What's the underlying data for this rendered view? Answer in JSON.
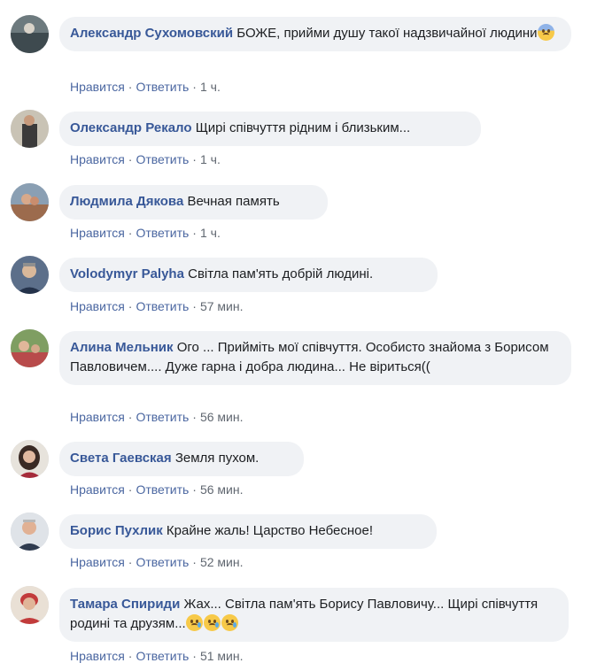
{
  "top_partial": "·",
  "comments": [
    {
      "author": "Александр Сухомовский",
      "text": "БОЖЕ, прийми душу такої надзвичайної людини",
      "emojis": [
        "fearful-face"
      ],
      "like": "Нравится",
      "reply": "Ответить",
      "time": "1 ч."
    },
    {
      "author": "Олександр Рекало",
      "text": "Щирі співчуття рідним і близьким...",
      "emojis": [],
      "like": "Нравится",
      "reply": "Ответить",
      "time": "1 ч."
    },
    {
      "author": "Людмила Дякова",
      "text": "Вечная память",
      "emojis": [],
      "like": "Нравится",
      "reply": "Ответить",
      "time": "1 ч."
    },
    {
      "author": "Volodymyr Palyha",
      "text": "Світла пам'ять добрій людині.",
      "emojis": [],
      "like": "Нравится",
      "reply": "Ответить",
      "time": "57 мин."
    },
    {
      "author": "Алина Мельник",
      "text": "Ого ... Прийміть мої співчуття. Особисто знайома з Борисом Павловичем.... Дуже гарна і добра людина... Не віриться((",
      "emojis": [],
      "like": "Нравится",
      "reply": "Ответить",
      "time": "56 мин."
    },
    {
      "author": "Света Гаевская",
      "text": "Земля пухом.",
      "emojis": [],
      "like": "Нравится",
      "reply": "Ответить",
      "time": "56 мин."
    },
    {
      "author": "Борис Пухлик",
      "text": "Крайне жаль! Царство Небесное!",
      "emojis": [],
      "like": "Нравится",
      "reply": "Ответить",
      "time": "52 мин."
    },
    {
      "author": "Тамара Спириди",
      "text": "Жах... Світла пам'ять Борису Павловичу... Щирі співчуття родині та друзям...",
      "emojis": [
        "crying-face",
        "crying-face",
        "crying-face"
      ],
      "like": "Нравится",
      "reply": "Ответить",
      "time": "51 мин."
    }
  ],
  "colors": {
    "author_link": "#385898",
    "bubble_bg": "#f0f2f5",
    "action_link": "#4b67a1"
  }
}
